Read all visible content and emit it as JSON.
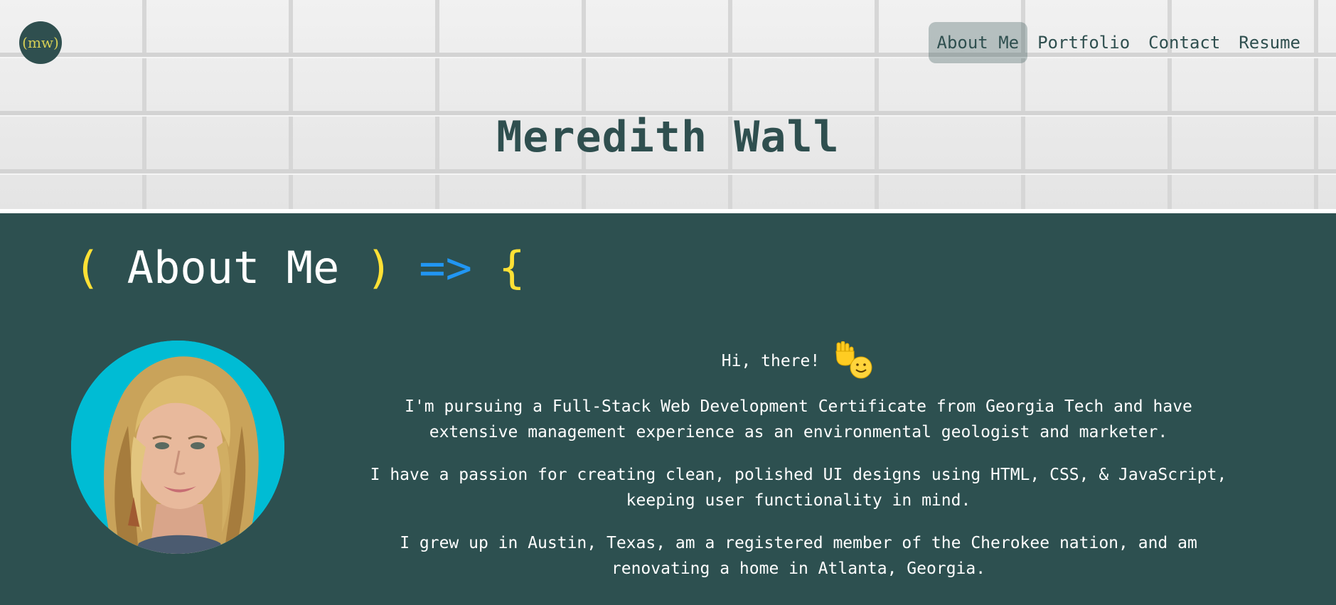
{
  "logo": {
    "text": "(mw)"
  },
  "nav": {
    "items": [
      {
        "label": "About Me",
        "active": true
      },
      {
        "label": "Portfolio",
        "active": false
      },
      {
        "label": "Contact",
        "active": false
      },
      {
        "label": "Resume",
        "active": false
      }
    ]
  },
  "header": {
    "title": "Meredith Wall"
  },
  "about": {
    "heading": {
      "open_paren": "(",
      "text": "About Me",
      "close_paren": ")",
      "arrow": "=>",
      "brace": "{"
    },
    "greeting": "Hi, there!",
    "paragraphs": [
      "I'm pursuing a Full-Stack Web Development Certificate from Georgia Tech and have extensive management experience as an environmental geologist and marketer.",
      "I have a passion for creating clean, polished UI designs using HTML, CSS, & JavaScript, keeping user functionality in mind.",
      "I grew up in Austin, Texas, am a registered member of the Cherokee nation, and am renovating a home in Atlanta, Georgia."
    ]
  },
  "colors": {
    "primary": "#2f4f4f",
    "accent_yellow": "#ffe135",
    "accent_blue": "#2196f3",
    "avatar_bg": "#00bcd4",
    "logo_text": "#d6cf55"
  },
  "icons": {
    "logo": "logo-badge",
    "greeting": "waving-hand-smiley-icon",
    "profile": "profile-photo"
  }
}
